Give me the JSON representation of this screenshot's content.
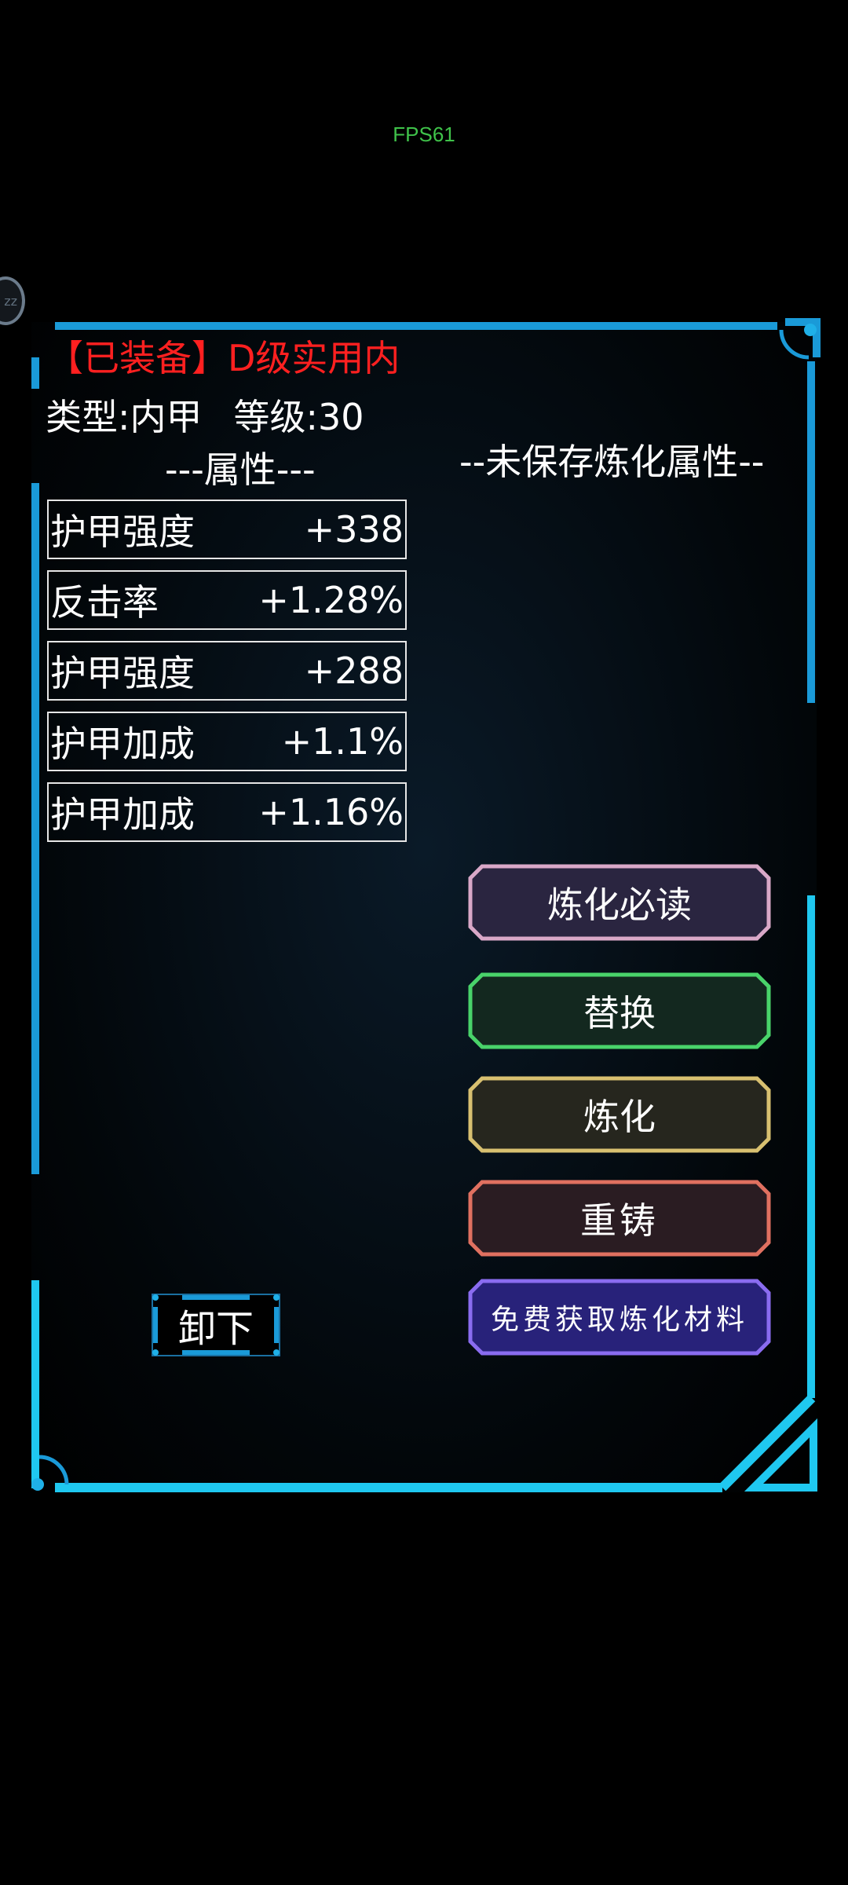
{
  "status": {
    "fps_text": "FPS61"
  },
  "side_bubble": {
    "text": "zz"
  },
  "item": {
    "title": "【已装备】D级实用内",
    "type_text": "类型:内甲",
    "level_text": "等级:30",
    "attributes_heading": "---属性---",
    "attributes": [
      {
        "name": "护甲强度",
        "value": "+338"
      },
      {
        "name": "反击率",
        "value": "+1.28%"
      },
      {
        "name": "护甲强度",
        "value": "+288"
      },
      {
        "name": "护甲加成",
        "value": "+1.1%"
      },
      {
        "name": "护甲加成",
        "value": "+1.16%"
      }
    ]
  },
  "refine": {
    "unsaved_heading": "--未保存炼化属性--",
    "buttons": {
      "guide": "炼化必读",
      "replace": "替换",
      "refine": "炼化",
      "recast": "重铸",
      "free_material": "免费获取炼化材料"
    }
  },
  "unequip_label": "卸下",
  "colors": {
    "frame_accent": "#1fc8f0",
    "title_red": "#ff2020",
    "guide_border": "#d9a8c8",
    "replace_border": "#49d36a",
    "refine_border": "#d8c070",
    "recast_border": "#e07060",
    "free_border": "#8a6cf0"
  }
}
